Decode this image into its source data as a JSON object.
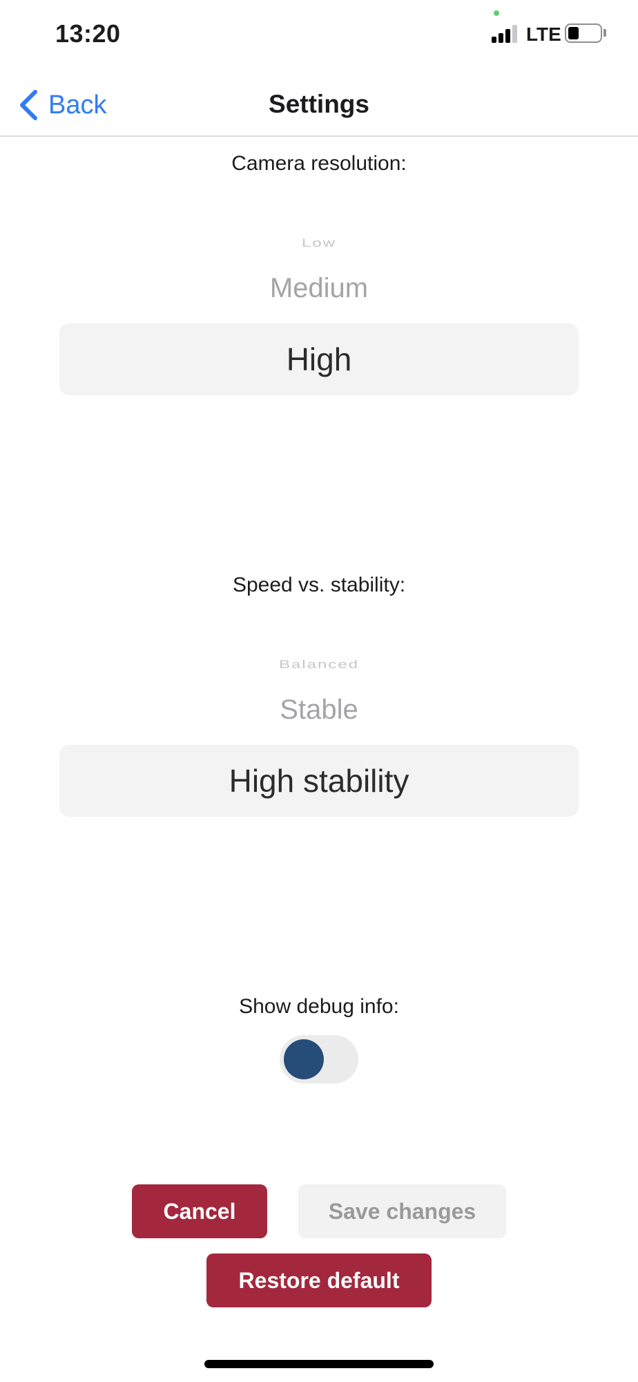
{
  "status_bar": {
    "time": "13:20",
    "network": "LTE"
  },
  "nav": {
    "back_label": "Back",
    "title": "Settings"
  },
  "camera_resolution": {
    "label": "Camera resolution:",
    "options_above": [
      "Low",
      "Medium"
    ],
    "selected": "High"
  },
  "speed_stability": {
    "label": "Speed vs. stability:",
    "options_above": [
      "Balanced",
      "Stable"
    ],
    "selected": "High stability"
  },
  "debug": {
    "label": "Show debug info:",
    "enabled": false
  },
  "buttons": {
    "cancel": "Cancel",
    "save": "Save changes",
    "restore": "Restore default"
  },
  "colors": {
    "accent_blue": "#2f7cf6",
    "primary_button": "#a3283e",
    "toggle_knob": "#264c78"
  }
}
